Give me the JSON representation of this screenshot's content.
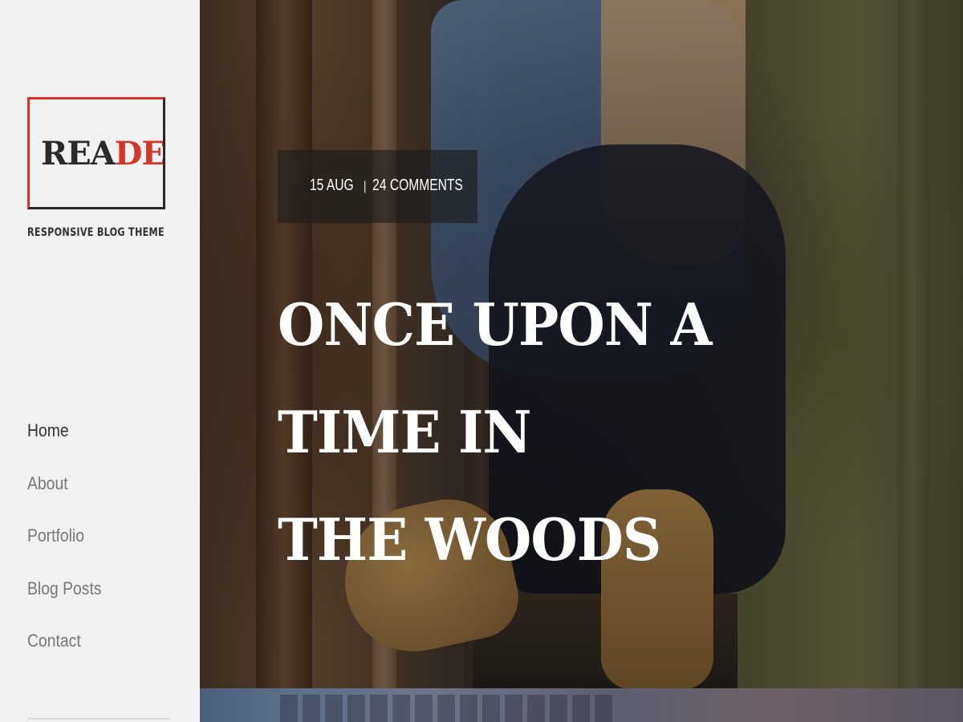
{
  "sidebar": {
    "logo": {
      "part_a": "REA",
      "part_b": "DER"
    },
    "tagline": "RESPONSIVE BLOG THEME",
    "nav": [
      {
        "label": "Home"
      },
      {
        "label": "About"
      },
      {
        "label": "Portfolio"
      },
      {
        "label": "Blog Posts"
      },
      {
        "label": "Contact"
      }
    ]
  },
  "hero": {
    "meta": {
      "date": "15 AUG",
      "separator": "|",
      "comments": "24 COMMENTS"
    },
    "title_lines": [
      "ONCE UPON A TIME IN",
      "THE WOODS"
    ]
  },
  "colors": {
    "brand_red": "#d6352a",
    "brand_dark": "#2a2a2a",
    "sidebar_bg": "#f1f1f1",
    "nav_text": "#777777",
    "nav_active": "#333333"
  }
}
